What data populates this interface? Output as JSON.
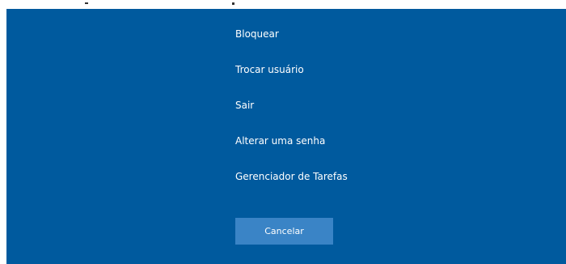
{
  "colors": {
    "background": "#005a9e",
    "button": "#3a84c6",
    "text": "#ffffff"
  },
  "menu": {
    "items": [
      {
        "label": "Bloquear"
      },
      {
        "label": "Trocar usuário"
      },
      {
        "label": "Sair"
      },
      {
        "label": "Alterar uma senha"
      },
      {
        "label": "Gerenciador de Tarefas"
      }
    ]
  },
  "actions": {
    "cancel_label": "Cancelar"
  }
}
